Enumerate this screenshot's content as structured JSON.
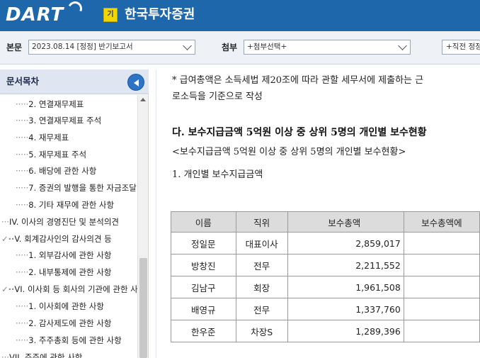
{
  "header": {
    "logo": "DART",
    "badge": "기",
    "company": "한국투자증권"
  },
  "toolbar": {
    "main_label": "본문",
    "main_value": "2023.08.14  [정정] 반기보고서",
    "attach_label": "첨부",
    "attach_value": "+첨부선택+",
    "prev_label": "+직전 정정"
  },
  "sidebar": {
    "title": "문서목차",
    "items": [
      {
        "dots": "·····",
        "label": "2. 연결재무제표"
      },
      {
        "dots": "·····",
        "label": "3. 연결재무제표 주석"
      },
      {
        "dots": "·····",
        "label": "4. 재무제표"
      },
      {
        "dots": "·····",
        "label": "5. 재무제표 주석"
      },
      {
        "dots": "·····",
        "label": "6. 배당에 관한 사항"
      },
      {
        "dots": "·····",
        "label": "7. 증권의 발행을 통한 자금조달"
      },
      {
        "dots": "·····",
        "label": "8. 기타 재무에 관한 사항"
      },
      {
        "dots": "···",
        "label": "IV. 이사의 경영진단 및 분석의견"
      },
      {
        "dots": "✓··",
        "label": "V. 회계감사인의 감사의견 등"
      },
      {
        "dots": "·····",
        "label": "1. 외부감사에 관한 사항"
      },
      {
        "dots": "·····",
        "label": "2. 내부통제에 관한 사항"
      },
      {
        "dots": "✓··",
        "label": "VI. 이사회 등 회사의 기관에 관한 사항"
      },
      {
        "dots": "·····",
        "label": "1. 이사회에 관한 사항"
      },
      {
        "dots": "·····",
        "label": "2. 감사제도에 관한 사항"
      },
      {
        "dots": "·····",
        "label": "3. 주주총회 등에 관한 사항"
      },
      {
        "dots": "···",
        "label": "VII. 주주에 관한 사항"
      }
    ]
  },
  "content": {
    "note_line1": "* 급여총액은 소득세법 제20조에 따라 관할 세무서에 제출하는 근",
    "note_line2": "로소득을 기준으로 작성",
    "heading": "다. 보수지급금액 5억원 이상 중 상위 5명의 개인별 보수현황",
    "subheading": "<보수지급금액 5억원 이상 중 상위 5명의 개인별 보수현황>",
    "section": "1. 개인별 보수지급금액",
    "table": {
      "headers": [
        "이름",
        "직위",
        "보수총액",
        "보수총액에"
      ],
      "rows": [
        {
          "name": "정일문",
          "position": "대표이사",
          "amount": "2,859,017"
        },
        {
          "name": "방창진",
          "position": "전무",
          "amount": "2,211,552"
        },
        {
          "name": "김남구",
          "position": "회장",
          "amount": "1,961,508"
        },
        {
          "name": "배영규",
          "position": "전무",
          "amount": "1,337,760"
        },
        {
          "name": "한우준",
          "position": "차장S",
          "amount": "1,289,396"
        }
      ]
    }
  },
  "colors": {
    "header_bg": "#1e67ab",
    "toolbar_bg": "#eef1f6",
    "sidebar_head_bg": "#dfe6f1",
    "accent": "#2f73c6",
    "table_header_bg": "#dcdcdc"
  }
}
